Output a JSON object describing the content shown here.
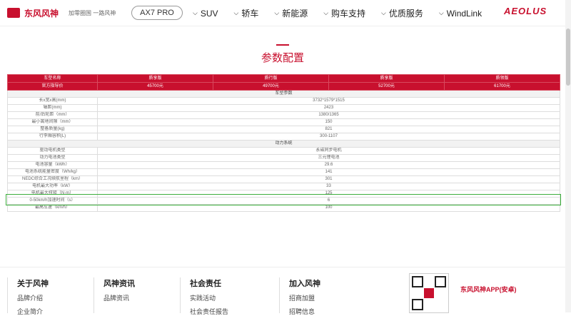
{
  "header": {
    "brand": "东风风神",
    "slogan": "加零圈国 一路风神",
    "model_pill": "AX7 PRO",
    "nav": [
      "SUV",
      "轿车",
      "新能源",
      "购车支持",
      "优质服务",
      "WindLink"
    ],
    "right_logo": "AEOLUS"
  },
  "page_title": "参数配置",
  "table": {
    "header_row1": [
      "车型名称",
      "质享版",
      "质行版",
      "质享版",
      "质领版"
    ],
    "header_row2": [
      "官方指导价",
      "45700元",
      "49700元",
      "52700元",
      "61700元"
    ],
    "sections": [
      {
        "title": "车型参数",
        "rows": [
          {
            "label": "长x宽x高(mm)",
            "value": "3732*1579*1515"
          },
          {
            "label": "轴距(mm)",
            "value": "2423"
          },
          {
            "label": "前/后轮距（mm）",
            "value": "1380/1365"
          },
          {
            "label": "最小离地间隙（mm）",
            "value": "150"
          },
          {
            "label": "整备质量(kg)",
            "value": "821"
          },
          {
            "label": "行李厢容积(L)",
            "value": "300-1107"
          }
        ]
      },
      {
        "title": "动力系统",
        "rows": [
          {
            "label": "驱动电机类型",
            "value": "永磁同步电机"
          },
          {
            "label": "动力电池类型",
            "value": "三元锂电池"
          },
          {
            "label": "电池容量（kWh）",
            "value": "29.6"
          },
          {
            "label": "电池系统能量密度（Wh/kg）",
            "value": "141"
          },
          {
            "label": "NEDC综合工况续航里程（km）",
            "value": "301"
          },
          {
            "label": "电机最大功率（kW）",
            "value": "33"
          },
          {
            "label": "电机最大扭矩（N·m）",
            "value": "125"
          },
          {
            "label": "0-50km/h加速时间（s）",
            "value": "6"
          },
          {
            "label": "最高车速（km/h）",
            "value": "100"
          }
        ]
      }
    ]
  },
  "footer": {
    "columns": [
      {
        "heading": "关于风神",
        "items": [
          "品牌介绍",
          "企业简介"
        ]
      },
      {
        "heading": "风神资讯",
        "items": [
          "品牌资讯"
        ]
      },
      {
        "heading": "社会责任",
        "items": [
          "实践活动",
          "社会责任报告"
        ]
      },
      {
        "heading": "加入风神",
        "items": [
          "招商加盟",
          "招聘信息"
        ]
      }
    ],
    "app_text": "东风风神APP(安卓)"
  }
}
